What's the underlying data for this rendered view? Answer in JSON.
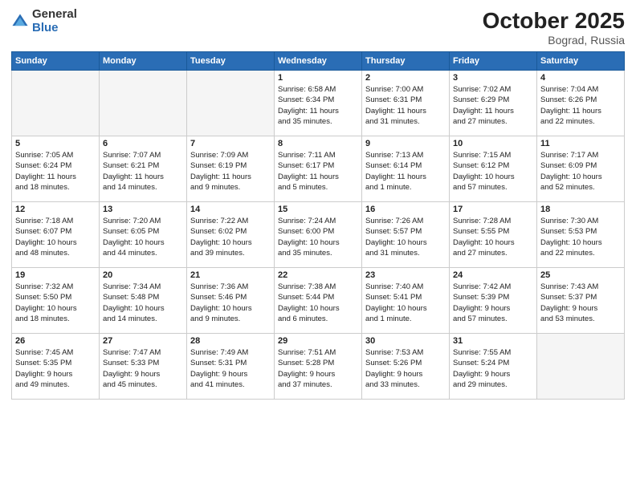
{
  "header": {
    "logo_general": "General",
    "logo_blue": "Blue",
    "title": "October 2025",
    "location": "Bograd, Russia"
  },
  "days_of_week": [
    "Sunday",
    "Monday",
    "Tuesday",
    "Wednesday",
    "Thursday",
    "Friday",
    "Saturday"
  ],
  "weeks": [
    [
      {
        "day": "",
        "info": "",
        "empty": true
      },
      {
        "day": "",
        "info": "",
        "empty": true
      },
      {
        "day": "",
        "info": "",
        "empty": true
      },
      {
        "day": "1",
        "info": "Sunrise: 6:58 AM\nSunset: 6:34 PM\nDaylight: 11 hours\nand 35 minutes.",
        "empty": false
      },
      {
        "day": "2",
        "info": "Sunrise: 7:00 AM\nSunset: 6:31 PM\nDaylight: 11 hours\nand 31 minutes.",
        "empty": false
      },
      {
        "day": "3",
        "info": "Sunrise: 7:02 AM\nSunset: 6:29 PM\nDaylight: 11 hours\nand 27 minutes.",
        "empty": false
      },
      {
        "day": "4",
        "info": "Sunrise: 7:04 AM\nSunset: 6:26 PM\nDaylight: 11 hours\nand 22 minutes.",
        "empty": false
      }
    ],
    [
      {
        "day": "5",
        "info": "Sunrise: 7:05 AM\nSunset: 6:24 PM\nDaylight: 11 hours\nand 18 minutes.",
        "empty": false
      },
      {
        "day": "6",
        "info": "Sunrise: 7:07 AM\nSunset: 6:21 PM\nDaylight: 11 hours\nand 14 minutes.",
        "empty": false
      },
      {
        "day": "7",
        "info": "Sunrise: 7:09 AM\nSunset: 6:19 PM\nDaylight: 11 hours\nand 9 minutes.",
        "empty": false
      },
      {
        "day": "8",
        "info": "Sunrise: 7:11 AM\nSunset: 6:17 PM\nDaylight: 11 hours\nand 5 minutes.",
        "empty": false
      },
      {
        "day": "9",
        "info": "Sunrise: 7:13 AM\nSunset: 6:14 PM\nDaylight: 11 hours\nand 1 minute.",
        "empty": false
      },
      {
        "day": "10",
        "info": "Sunrise: 7:15 AM\nSunset: 6:12 PM\nDaylight: 10 hours\nand 57 minutes.",
        "empty": false
      },
      {
        "day": "11",
        "info": "Sunrise: 7:17 AM\nSunset: 6:09 PM\nDaylight: 10 hours\nand 52 minutes.",
        "empty": false
      }
    ],
    [
      {
        "day": "12",
        "info": "Sunrise: 7:18 AM\nSunset: 6:07 PM\nDaylight: 10 hours\nand 48 minutes.",
        "empty": false
      },
      {
        "day": "13",
        "info": "Sunrise: 7:20 AM\nSunset: 6:05 PM\nDaylight: 10 hours\nand 44 minutes.",
        "empty": false
      },
      {
        "day": "14",
        "info": "Sunrise: 7:22 AM\nSunset: 6:02 PM\nDaylight: 10 hours\nand 39 minutes.",
        "empty": false
      },
      {
        "day": "15",
        "info": "Sunrise: 7:24 AM\nSunset: 6:00 PM\nDaylight: 10 hours\nand 35 minutes.",
        "empty": false
      },
      {
        "day": "16",
        "info": "Sunrise: 7:26 AM\nSunset: 5:57 PM\nDaylight: 10 hours\nand 31 minutes.",
        "empty": false
      },
      {
        "day": "17",
        "info": "Sunrise: 7:28 AM\nSunset: 5:55 PM\nDaylight: 10 hours\nand 27 minutes.",
        "empty": false
      },
      {
        "day": "18",
        "info": "Sunrise: 7:30 AM\nSunset: 5:53 PM\nDaylight: 10 hours\nand 22 minutes.",
        "empty": false
      }
    ],
    [
      {
        "day": "19",
        "info": "Sunrise: 7:32 AM\nSunset: 5:50 PM\nDaylight: 10 hours\nand 18 minutes.",
        "empty": false
      },
      {
        "day": "20",
        "info": "Sunrise: 7:34 AM\nSunset: 5:48 PM\nDaylight: 10 hours\nand 14 minutes.",
        "empty": false
      },
      {
        "day": "21",
        "info": "Sunrise: 7:36 AM\nSunset: 5:46 PM\nDaylight: 10 hours\nand 9 minutes.",
        "empty": false
      },
      {
        "day": "22",
        "info": "Sunrise: 7:38 AM\nSunset: 5:44 PM\nDaylight: 10 hours\nand 6 minutes.",
        "empty": false
      },
      {
        "day": "23",
        "info": "Sunrise: 7:40 AM\nSunset: 5:41 PM\nDaylight: 10 hours\nand 1 minute.",
        "empty": false
      },
      {
        "day": "24",
        "info": "Sunrise: 7:42 AM\nSunset: 5:39 PM\nDaylight: 9 hours\nand 57 minutes.",
        "empty": false
      },
      {
        "day": "25",
        "info": "Sunrise: 7:43 AM\nSunset: 5:37 PM\nDaylight: 9 hours\nand 53 minutes.",
        "empty": false
      }
    ],
    [
      {
        "day": "26",
        "info": "Sunrise: 7:45 AM\nSunset: 5:35 PM\nDaylight: 9 hours\nand 49 minutes.",
        "empty": false
      },
      {
        "day": "27",
        "info": "Sunrise: 7:47 AM\nSunset: 5:33 PM\nDaylight: 9 hours\nand 45 minutes.",
        "empty": false
      },
      {
        "day": "28",
        "info": "Sunrise: 7:49 AM\nSunset: 5:31 PM\nDaylight: 9 hours\nand 41 minutes.",
        "empty": false
      },
      {
        "day": "29",
        "info": "Sunrise: 7:51 AM\nSunset: 5:28 PM\nDaylight: 9 hours\nand 37 minutes.",
        "empty": false
      },
      {
        "day": "30",
        "info": "Sunrise: 7:53 AM\nSunset: 5:26 PM\nDaylight: 9 hours\nand 33 minutes.",
        "empty": false
      },
      {
        "day": "31",
        "info": "Sunrise: 7:55 AM\nSunset: 5:24 PM\nDaylight: 9 hours\nand 29 minutes.",
        "empty": false
      },
      {
        "day": "",
        "info": "",
        "empty": true
      }
    ]
  ]
}
